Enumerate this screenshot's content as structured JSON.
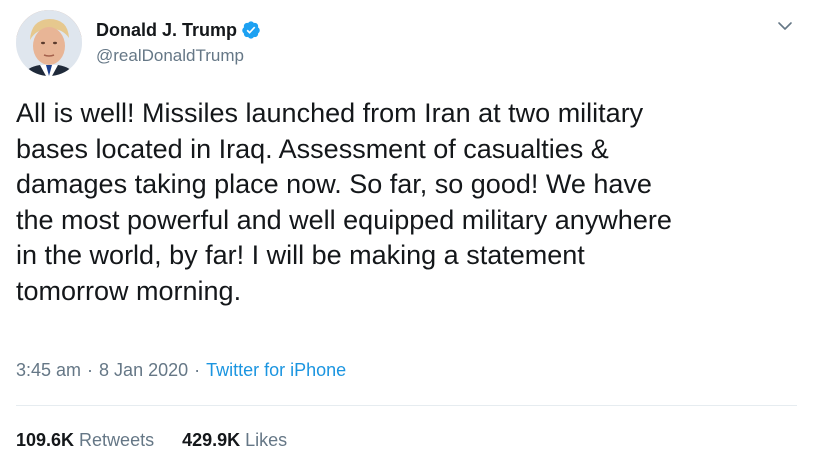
{
  "author": {
    "display_name": "Donald J. Trump",
    "handle": "@realDonaldTrump",
    "verified": true
  },
  "tweet": {
    "text": "All is well! Missiles launched from Iran at two military\nbases located in Iraq. Assessment of casualties &\ndamages taking place now. So far, so good! We have\nthe most powerful and well equipped military anywhere\nin the world, by far! I will be making a statement\ntomorrow morning."
  },
  "meta": {
    "time": "3:45 am",
    "separator": "·",
    "date": "8 Jan 2020",
    "source": "Twitter for iPhone"
  },
  "stats": {
    "retweets_count": "109.6K",
    "retweets_label": "Retweets",
    "likes_count": "429.9K",
    "likes_label": "Likes"
  },
  "icons": {
    "verified": "verified-badge-icon",
    "menu": "chevron-down-icon"
  },
  "colors": {
    "text": "#14171a",
    "secondary": "#657786",
    "link": "#1b95e0",
    "verified": "#1da1f2",
    "divider": "#e6ecf0"
  }
}
